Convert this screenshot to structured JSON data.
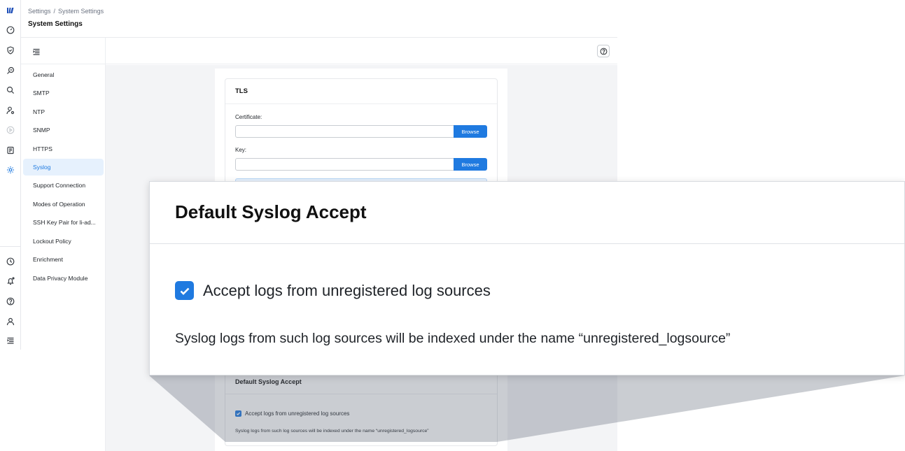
{
  "breadcrumb": {
    "root": "Settings",
    "separator": "/",
    "current": "System Settings"
  },
  "page_title": "System Settings",
  "rail": {
    "icons": [
      "logo-icon",
      "dashboard-icon",
      "shield-icon",
      "investigate-icon",
      "search-icon",
      "user-settings-icon",
      "play-icon",
      "report-icon",
      "gear-icon",
      "clock-icon",
      "notification-icon",
      "help-icon",
      "user-icon",
      "menu-icon"
    ]
  },
  "nav": {
    "items": [
      "General",
      "SMTP",
      "NTP",
      "SNMP",
      "HTTPS",
      "Syslog",
      "Support Connection",
      "Modes of Operation",
      "SSH Key Pair for li-ad...",
      "Lockout Policy",
      "Enrichment",
      "Data Privacy Module"
    ],
    "active": "Syslog"
  },
  "tls": {
    "title": "TLS",
    "certificate_label": "Certificate:",
    "certificate_value": "",
    "key_label": "Key:",
    "key_value": "",
    "browse_label": "Browse"
  },
  "syslog_accept": {
    "title": "Default Syslog Accept",
    "checkbox_label": "Accept logs from unregistered log sources",
    "checked": true,
    "note": "Syslog logs from such log sources will be indexed under the name “unregistered_logsource”"
  },
  "colors": {
    "accent": "#1f7ae0",
    "active_bg": "#e6f1fd",
    "content_bg": "#f3f4f6"
  }
}
